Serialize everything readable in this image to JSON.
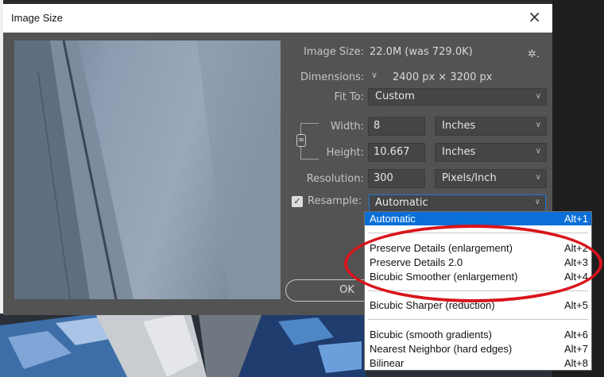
{
  "dialog": {
    "title": "Image Size",
    "close_glyph": "×"
  },
  "info": {
    "image_size_label": "Image Size:",
    "image_size_value": "22.0M (was 729.0K)",
    "dimensions_label": "Dimensions:",
    "dimensions_value": "2400 px  ×  3200 px",
    "gear_glyph": "✲."
  },
  "fit_to": {
    "label": "Fit To:",
    "value": "Custom"
  },
  "width": {
    "label": "Width:",
    "value": "8",
    "unit": "Inches"
  },
  "height": {
    "label": "Height:",
    "value": "10.667",
    "unit": "Inches"
  },
  "resolution": {
    "label": "Resolution:",
    "value": "300",
    "unit": "Pixels/Inch"
  },
  "resample": {
    "label": "Resample:",
    "checked": true,
    "value": "Automatic"
  },
  "ok_label": "OK",
  "dropdown": {
    "items": [
      {
        "name": "Automatic",
        "shortcut": "Alt+1"
      },
      {
        "name": "Preserve Details (enlargement)",
        "shortcut": "Alt+2"
      },
      {
        "name": "Preserve Details 2.0",
        "shortcut": "Alt+3"
      },
      {
        "name": "Bicubic Smoother (enlargement)",
        "shortcut": "Alt+4"
      },
      {
        "name": "Bicubic Sharper (reduction)",
        "shortcut": "Alt+5"
      },
      {
        "name": "Bicubic (smooth gradients)",
        "shortcut": "Alt+6"
      },
      {
        "name": "Nearest Neighbor (hard edges)",
        "shortcut": "Alt+7"
      },
      {
        "name": "Bilinear",
        "shortcut": "Alt+8"
      }
    ]
  },
  "icons": {
    "close": "close-icon",
    "gear": "gear-icon",
    "chain": "link-constrain-icon",
    "caret": "chevron-down-icon",
    "check": "checkmark-icon"
  },
  "colors": {
    "dialog_bg": "#535353",
    "field_bg": "#454545",
    "selection_blue": "#0a6fd6",
    "focus_border": "#1f7ad8",
    "annotation_red": "#d9141c"
  }
}
